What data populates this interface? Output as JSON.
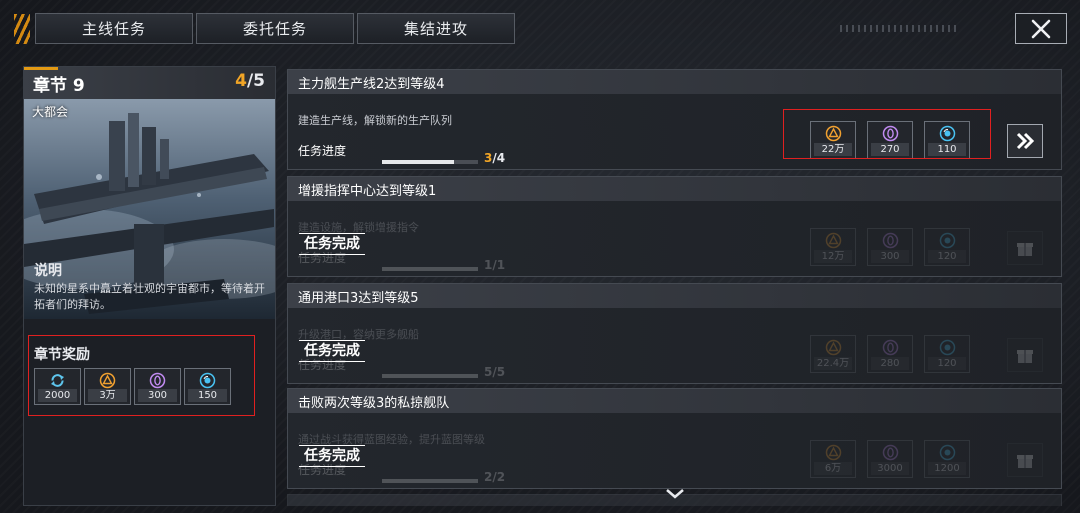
{
  "tabs": [
    {
      "label": "主线任务",
      "active": true
    },
    {
      "label": "委托任务",
      "active": false
    },
    {
      "label": "集结进攻",
      "active": false
    }
  ],
  "close_icon": "close-icon",
  "chapter": {
    "title": "章节 9",
    "progress_current": "4",
    "progress_total": "/5",
    "subtitle": "大都会",
    "description_title": "说明",
    "description": "未知的星系中矗立着壮观的宇宙都市，等待着开拓者们的拜访。",
    "reward_title": "章节奖励",
    "rewards": [
      {
        "icon": "refresh-icon",
        "value": "2000"
      },
      {
        "icon": "triangle-resource-icon",
        "value": "3万"
      },
      {
        "icon": "crystal-resource-icon",
        "value": "300"
      },
      {
        "icon": "energy-orb-icon",
        "value": "150"
      }
    ]
  },
  "missions": [
    {
      "title": "主力舰生产线2达到等级4",
      "description": "建造生产线，解锁新的生产队列",
      "progress_label": "任务进度",
      "progress_current": "3",
      "progress_total": "/4",
      "progress_fraction": 0.75,
      "completed": false,
      "completed_label": "",
      "rewards": [
        {
          "icon": "triangle-resource-icon",
          "value": "22万"
        },
        {
          "icon": "crystal-resource-icon",
          "value": "270"
        },
        {
          "icon": "energy-orb-icon",
          "value": "110"
        }
      ],
      "action_icon": "double-chevron-right-icon"
    },
    {
      "title": "增援指挥中心达到等级1",
      "description": "建造设施，解锁增援指令",
      "progress_label": "任务进度",
      "progress_current": "1",
      "progress_total": "/1",
      "progress_fraction": 1.0,
      "completed": true,
      "completed_label": "任务完成",
      "rewards": [
        {
          "icon": "triangle-resource-icon",
          "value": "12万"
        },
        {
          "icon": "crystal-resource-icon",
          "value": "300"
        },
        {
          "icon": "energy-orb-icon",
          "value": "120"
        }
      ],
      "action_icon": "gift-icon"
    },
    {
      "title": "通用港口3达到等级5",
      "description": "升级港口，容纳更多舰船",
      "progress_label": "任务进度",
      "progress_current": "5",
      "progress_total": "/5",
      "progress_fraction": 1.0,
      "completed": true,
      "completed_label": "任务完成",
      "rewards": [
        {
          "icon": "triangle-resource-icon",
          "value": "22.4万"
        },
        {
          "icon": "crystal-resource-icon",
          "value": "280"
        },
        {
          "icon": "energy-orb-icon",
          "value": "120"
        }
      ],
      "action_icon": "gift-icon"
    },
    {
      "title": "击败两次等级3的私掠舰队",
      "description": "通过战斗获得蓝图经验，提升蓝图等级",
      "progress_label": "任务进度",
      "progress_current": "2",
      "progress_total": "/2",
      "progress_fraction": 1.0,
      "completed": true,
      "completed_label": "任务完成",
      "rewards": [
        {
          "icon": "triangle-resource-icon",
          "value": "6万"
        },
        {
          "icon": "crystal-resource-icon",
          "value": "3000"
        },
        {
          "icon": "energy-orb-icon",
          "value": "1200"
        }
      ],
      "action_icon": "gift-icon"
    }
  ],
  "scroll_icon": "chevron-down-icon",
  "colors": {
    "accent": "#f1a526",
    "tab_active": "#e9a11c",
    "highlight_box": "#e02020",
    "triangle": "#f0a030",
    "crystal": "#c08af0",
    "energy": "#49c2f2",
    "refresh": "#5ec6ee"
  }
}
